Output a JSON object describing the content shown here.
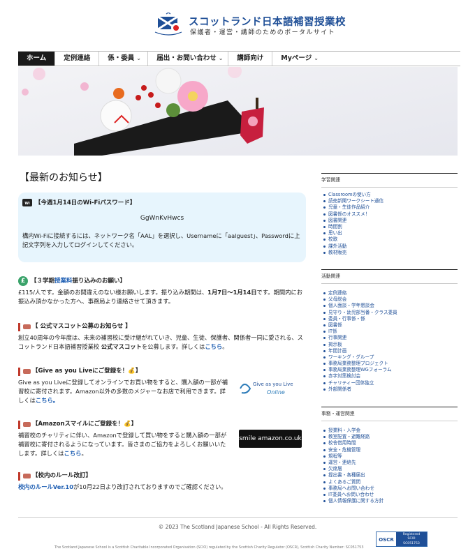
{
  "header": {
    "title": "スコットランド日本語補習授業校",
    "subtitle": "保護者・運営・講師のためのポータルサイト"
  },
  "nav": {
    "items": [
      {
        "label": "ホーム",
        "active": true
      },
      {
        "label": "定例連絡"
      },
      {
        "label": "係・委員",
        "chevron": "⌄"
      },
      {
        "label": "届出・お問い合わせ",
        "chevron": "⌄"
      },
      {
        "label": "講師向け"
      },
      {
        "label": "Myページ",
        "chevron": "⌄"
      }
    ]
  },
  "main": {
    "title": "【最新のお知らせ】",
    "wifi": {
      "heading": "【今週1月14日のWi-Fiパスワード】",
      "password": "GgWnKvHwcs",
      "body": "構内Wi-Fiに接続するには、ネットワーク名「AAL」を選択し、Usernameに「aalguest」、Passwordに上記文字列を入力してログインしてください。"
    },
    "fee": {
      "heading_pre": "【３学期",
      "heading_link": "授業料",
      "heading_post": "振り込みのお願い】",
      "body_1": "£115/人です。金額のお間違えのない様お願いします。振り込み期間は、",
      "body_period": "1月7日〜1月14日",
      "body_2": "です。期間内にお振込み頂かなかった方へ、事務局より連絡させて頂きます。"
    },
    "mascot": {
      "heading": "【 公式マスコット公募のお知らせ 】",
      "body_1": "創立40周年の今年度は、未来の補習校に受け継がれていき、児童、生徒、保護者、関係者一同に愛される、スコットランド日本語補習授業校 ",
      "body_bold": "公式マスコット",
      "body_2": "を公募します。詳しくは",
      "link": "こちら",
      "end": "。"
    },
    "giveasyoulive": {
      "heading": "【Give as you Liveにご登録を！💰】",
      "body": "Give as you Liveに登録してオンラインでお買い物をすると、購入額の一部が補習校に寄付されます。Amazon以外の多数のメジャーなお店で利用できます。詳しくは",
      "link": "こちら。",
      "logo_top": "Give as you Live",
      "logo_bottom": "Online"
    },
    "amazon": {
      "heading": "【Amazonスマイルにご登録を！💰】",
      "body": "補習校のチャリティに伴い、Amazonで登録して買い物をすると購入額の一部が補習校に寄付されるようになっています。皆さまのご協力をよろしくお願いいたします。詳しくは",
      "link": "こちら",
      "end": "。",
      "logo": "smile amazon.co.uk"
    },
    "rules": {
      "heading": "【校内のルール改訂】",
      "link": "校内のルールVer.10",
      "body": "が10月22日より改訂されておりますのでご確認ください。"
    }
  },
  "sidebar": {
    "sections": [
      {
        "title": "学習関連",
        "items": [
          "Classroomの使い方",
          "読売新聞ワークシート通信",
          "児童・生徒作品紹介",
          "図書係のオススメ！",
          "図書関連",
          "時間割",
          "思い出",
          "校歌",
          "課外活動",
          "教材販売"
        ]
      },
      {
        "title": "活動関連",
        "items": [
          "定例連絡",
          "父母総会",
          "個人面談・学年懇談会",
          "見守り・幼児部当番・クラス委員",
          "委員・行事係・係",
          "図書係",
          "IT係",
          "行事関連",
          "掲示板",
          "年間計画",
          "ワーキング・グループ",
          "事務局業務整理プロジェクト",
          "事務局業務整理WGフォーラム",
          "赤字対策検討会",
          "チャリティー団体独立",
          "外部関係者"
        ]
      },
      {
        "title": "事務・運営関連",
        "items": [
          "授業料・入学金",
          "教室配置・避難経路",
          "校舎借用時間",
          "安全・危機管理",
          "規程等",
          "運営・連絡先",
          "欠席届",
          "提出書・各種届出",
          "よくあるご質問",
          "事務局へお問い合わせ",
          "IT委員へお問い合わせ",
          "個人情報保護に関する方針"
        ]
      }
    ]
  },
  "footer": {
    "copyright": "© 2023 The Scotland Japanese School - All Rights Reserved.",
    "charity": "The Scotland Japanese School is a Scottish Charitable Incorporated Organisation (SCIO) regulated by the Scottish Charity Regulator (OSCR), Scottish Charity Number: SC051753",
    "oscr_left": "OSCR",
    "oscr_right_1": "Registered",
    "oscr_right_2": "SCIO",
    "oscr_right_3": "SC051753"
  }
}
